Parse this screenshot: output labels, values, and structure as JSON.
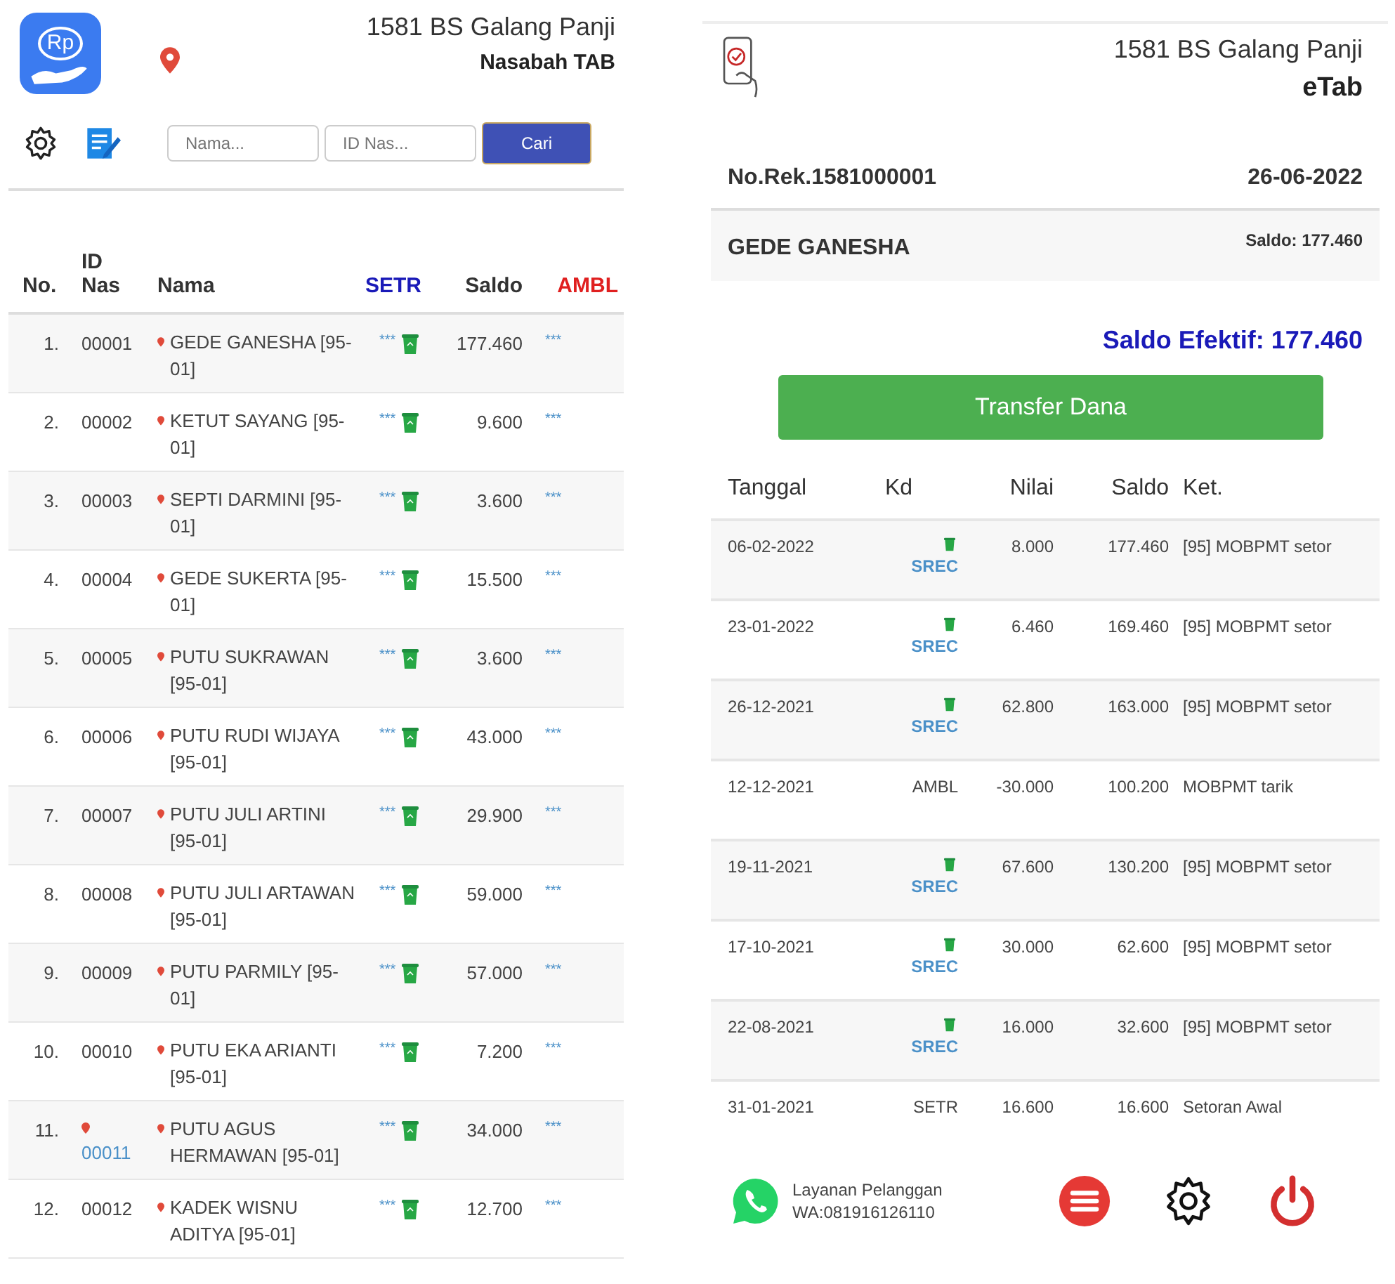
{
  "left": {
    "logo_text": "Rp",
    "title": "1581 BS Galang Panji",
    "subtitle": "Nasabah TAB",
    "search": {
      "name_placeholder": "Nama...",
      "id_placeholder": "ID Nas...",
      "button": "Cari"
    },
    "columns": [
      "No.",
      "ID Nas",
      "Nama",
      "SETR",
      "Saldo",
      "AMBL"
    ],
    "rows": [
      {
        "no": "1.",
        "id": "00001",
        "id_marked": false,
        "name": "GEDE GANESHA [95-01]",
        "setr": "***",
        "saldo": "177.460",
        "ambl": "***"
      },
      {
        "no": "2.",
        "id": "00002",
        "id_marked": false,
        "name": "KETUT SAYANG [95-01]",
        "setr": "***",
        "saldo": "9.600",
        "ambl": "***"
      },
      {
        "no": "3.",
        "id": "00003",
        "id_marked": false,
        "name": "SEPTI DARMINI [95-01]",
        "setr": "***",
        "saldo": "3.600",
        "ambl": "***"
      },
      {
        "no": "4.",
        "id": "00004",
        "id_marked": false,
        "name": "GEDE SUKERTA [95-01]",
        "setr": "***",
        "saldo": "15.500",
        "ambl": "***"
      },
      {
        "no": "5.",
        "id": "00005",
        "id_marked": false,
        "name": "PUTU SUKRAWAN [95-01]",
        "setr": "***",
        "saldo": "3.600",
        "ambl": "***"
      },
      {
        "no": "6.",
        "id": "00006",
        "id_marked": false,
        "name": "PUTU RUDI WIJAYA [95-01]",
        "setr": "***",
        "saldo": "43.000",
        "ambl": "***"
      },
      {
        "no": "7.",
        "id": "00007",
        "id_marked": false,
        "name": "PUTU JULI ARTINI [95-01]",
        "setr": "***",
        "saldo": "29.900",
        "ambl": "***"
      },
      {
        "no": "8.",
        "id": "00008",
        "id_marked": false,
        "name": "PUTU JULI ARTAWAN [95-01]",
        "setr": "***",
        "saldo": "59.000",
        "ambl": "***"
      },
      {
        "no": "9.",
        "id": "00009",
        "id_marked": false,
        "name": "PUTU PARMILY [95-01]",
        "setr": "***",
        "saldo": "57.000",
        "ambl": "***"
      },
      {
        "no": "10.",
        "id": "00010",
        "id_marked": false,
        "name": "PUTU EKA ARIANTI [95-01]",
        "setr": "***",
        "saldo": "7.200",
        "ambl": "***"
      },
      {
        "no": "11.",
        "id": "00011",
        "id_marked": true,
        "name": "PUTU AGUS HERMAWAN [95-01]",
        "setr": "***",
        "saldo": "34.000",
        "ambl": "***"
      },
      {
        "no": "12.",
        "id": "00012",
        "id_marked": false,
        "name": "KADEK WISNU ADITYA [95-01]",
        "setr": "***",
        "saldo": "12.700",
        "ambl": "***"
      }
    ]
  },
  "right": {
    "title": "1581 BS Galang Panji",
    "subtitle": "eTab",
    "account": "No.Rek.1581000001",
    "date": "26-06-2022",
    "customer": "GEDE GANESHA",
    "saldo": "Saldo: 177.460",
    "saldo_efektif": "Saldo Efektif: 177.460",
    "transfer_button": "Transfer Dana",
    "columns": [
      "Tanggal",
      "Kd",
      "Nilai",
      "Saldo",
      "Ket."
    ],
    "rows": [
      {
        "date": "06-02-2022",
        "kind": "srec",
        "kd": "SREC",
        "nilai": "8.000",
        "saldo": "177.460",
        "ket": "[95] MOBPMT setor"
      },
      {
        "date": "23-01-2022",
        "kind": "srec",
        "kd": "SREC",
        "nilai": "6.460",
        "saldo": "169.460",
        "ket": "[95] MOBPMT setor"
      },
      {
        "date": "26-12-2021",
        "kind": "srec",
        "kd": "SREC",
        "nilai": "62.800",
        "saldo": "163.000",
        "ket": "[95] MOBPMT setor"
      },
      {
        "date": "12-12-2021",
        "kind": "plain",
        "kd": "AMBL",
        "nilai": "-30.000",
        "saldo": "100.200",
        "ket": "MOBPMT tarik"
      },
      {
        "date": "19-11-2021",
        "kind": "srec",
        "kd": "SREC",
        "nilai": "67.600",
        "saldo": "130.200",
        "ket": "[95] MOBPMT setor"
      },
      {
        "date": "17-10-2021",
        "kind": "srec",
        "kd": "SREC",
        "nilai": "30.000",
        "saldo": "62.600",
        "ket": "[95] MOBPMT setor"
      },
      {
        "date": "22-08-2021",
        "kind": "srec",
        "kd": "SREC",
        "nilai": "16.000",
        "saldo": "32.600",
        "ket": "[95] MOBPMT setor"
      },
      {
        "date": "31-01-2021",
        "kind": "plain",
        "kd": "SETR",
        "nilai": "16.600",
        "saldo": "16.600",
        "ket": "Setoran Awal"
      }
    ],
    "support": {
      "label": "Layanan Pelanggan",
      "phone": "WA:081916126110"
    }
  }
}
